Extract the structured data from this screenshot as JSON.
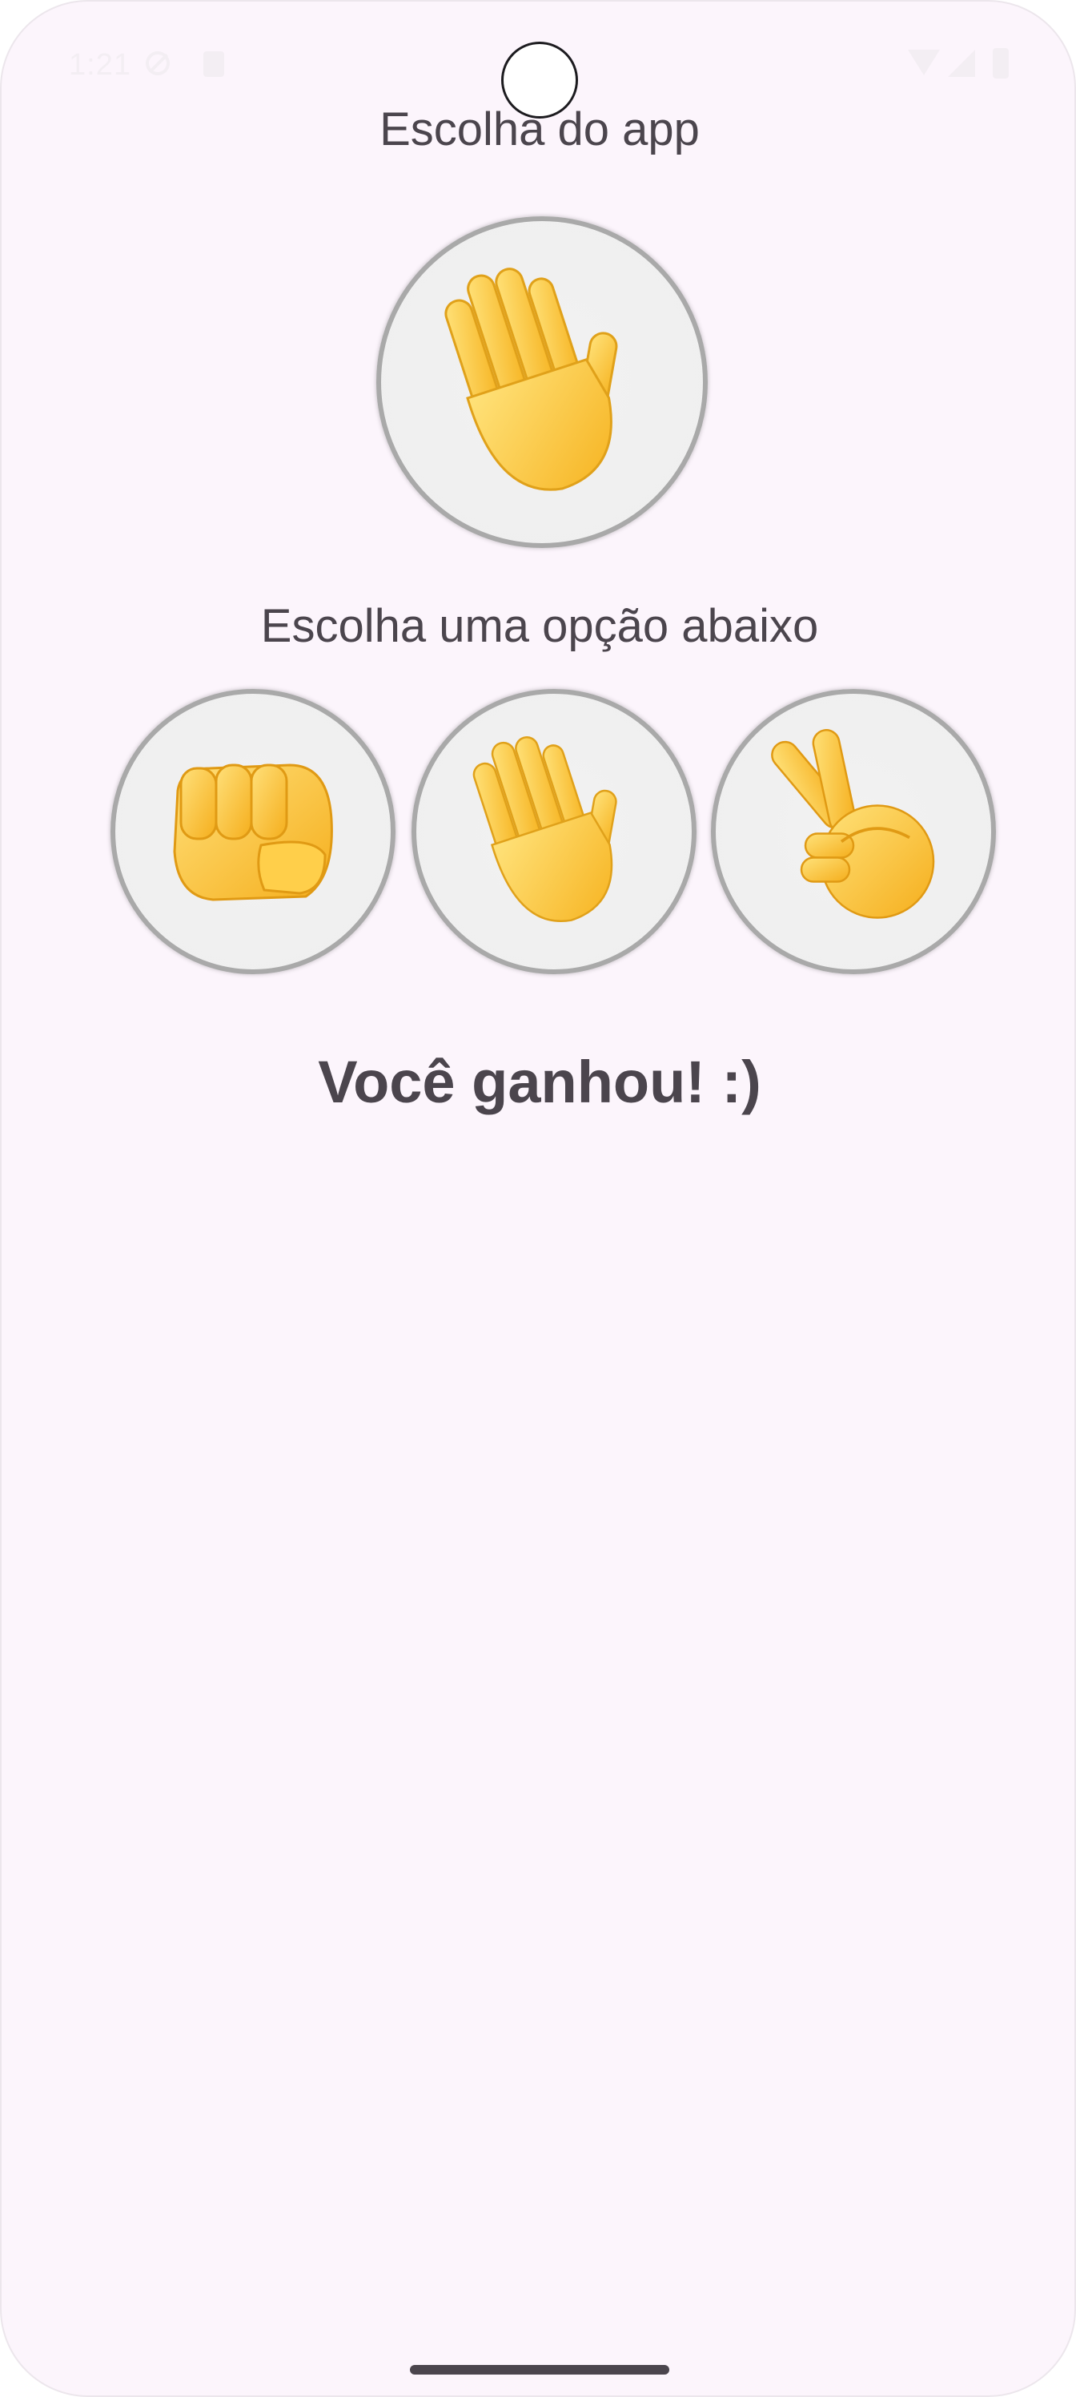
{
  "status_bar": {
    "time": "1:21",
    "icons": [
      "do-not-disturb-icon",
      "sim-card-icon",
      "wifi-icon",
      "signal-icon",
      "battery-icon"
    ]
  },
  "app_choice": {
    "heading": "Escolha do app",
    "selected": "paper",
    "icon": "raised-hand-icon"
  },
  "user_choice": {
    "heading": "Escolha uma opção abaixo",
    "options": [
      {
        "id": "rock",
        "icon": "fist-icon"
      },
      {
        "id": "paper",
        "icon": "raised-hand-icon"
      },
      {
        "id": "scissors",
        "icon": "victory-hand-icon"
      }
    ]
  },
  "result": {
    "text": "Você ganhou! :)"
  },
  "colors": {
    "background": "#fcf5fc",
    "text": "#4b454d",
    "circle_fill": "#efefef",
    "circle_border": "#a9a9a9",
    "emoji_yellow": "#fbc02d"
  }
}
